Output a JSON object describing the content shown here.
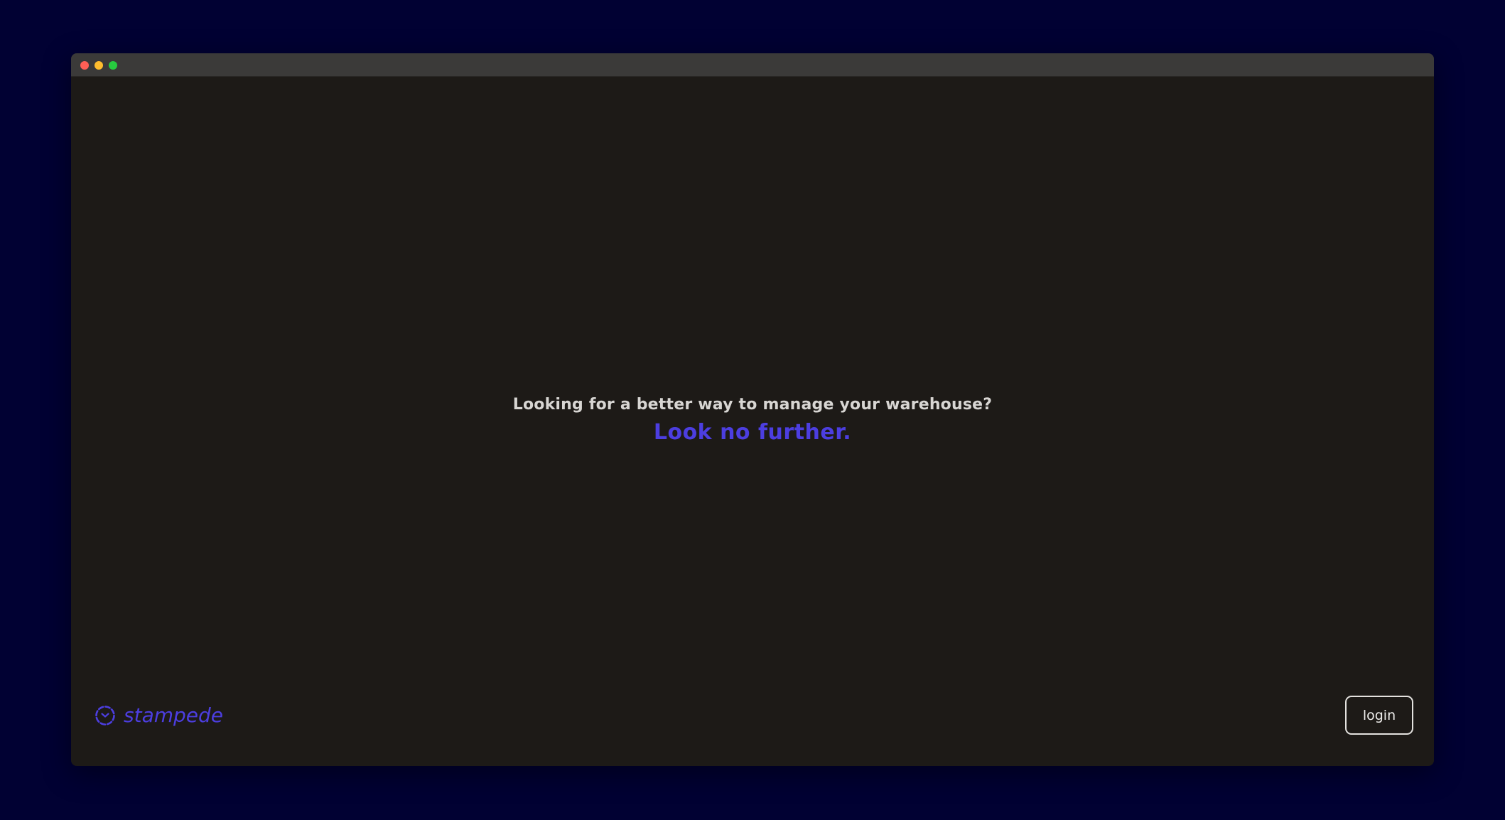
{
  "window": {
    "controls": [
      "close",
      "minimize",
      "maximize"
    ]
  },
  "hero": {
    "question": "Looking for a better way to manage your warehouse?",
    "answer": "Look no further."
  },
  "brand": {
    "name": "stampede",
    "icon": "dashed-circle-logo-icon"
  },
  "login": {
    "label": "login"
  },
  "colors": {
    "page_background": "#010133",
    "window_background": "#1d1a17",
    "titlebar": "#3b3a39",
    "accent": "#4c3ee0",
    "question_text": "#d8d6d3"
  }
}
